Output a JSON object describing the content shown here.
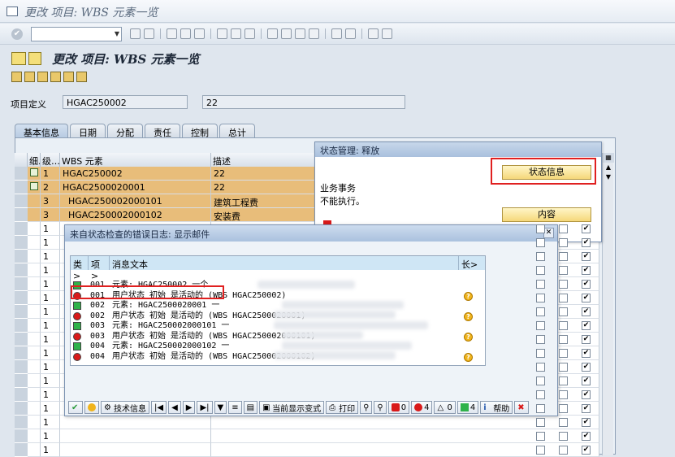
{
  "window": {
    "title": "更改 项目: WBS 元素一览"
  },
  "screen": {
    "title": "更改 项目: WBS 元素一览"
  },
  "project": {
    "label": "项目定义",
    "id": "HGAC250002",
    "desc": "22"
  },
  "tabs": [
    "基本信息",
    "日期",
    "分配",
    "责任",
    "控制",
    "总计"
  ],
  "grid": {
    "headers": {
      "a": "细.",
      "b": "级…",
      "c": "WBS 元素",
      "d": "描述"
    },
    "rows": [
      {
        "lvl": "1",
        "wbs": "HGAC250002",
        "desc": "22"
      },
      {
        "lvl": "2",
        "wbs": "HGAC2500020001",
        "desc": "22"
      },
      {
        "lvl": "3",
        "wbs": "HGAC250002000101",
        "desc": "建筑工程费"
      },
      {
        "lvl": "3",
        "wbs": "HGAC250002000102",
        "desc": "安装费"
      },
      {
        "lvl": "1"
      },
      {
        "lvl": "1"
      },
      {
        "lvl": "1"
      },
      {
        "lvl": "1"
      },
      {
        "lvl": "1"
      },
      {
        "lvl": "1"
      },
      {
        "lvl": "1"
      },
      {
        "lvl": "1"
      },
      {
        "lvl": "1"
      },
      {
        "lvl": "1"
      },
      {
        "lvl": "1"
      },
      {
        "lvl": "1"
      },
      {
        "lvl": "1"
      },
      {
        "lvl": "1"
      },
      {
        "lvl": "1"
      },
      {
        "lvl": "1"
      },
      {
        "lvl": "1"
      }
    ]
  },
  "status_dialog": {
    "title": "状态管理: 释放",
    "status_btn": "状态信息",
    "line1": "业务事务",
    "line2": "不能执行。",
    "content_btn": "内容"
  },
  "error_dialog": {
    "title": "来自状态检查的错误日志: 显示邮件",
    "col_type": "类>",
    "col_item": "项>",
    "col_text": "消息文本",
    "col_len": "长>",
    "messages": [
      {
        "type": "green",
        "num": "001",
        "text": "元素:  HGAC250002  一个"
      },
      {
        "type": "red",
        "num": "001",
        "text": "用户状态 初始 是活动的 (WBS HGAC250002)"
      },
      {
        "type": "green",
        "num": "002",
        "text": "元素:  HGAC2500020001  一"
      },
      {
        "type": "red",
        "num": "002",
        "text": "用户状态 初始 是活动的 (WBS HGAC2500020001)"
      },
      {
        "type": "green",
        "num": "003",
        "text": "元素:  HGAC250002000101  一"
      },
      {
        "type": "red",
        "num": "003",
        "text": "用户状态 初始 是活动的 (WBS HGAC250002000101)"
      },
      {
        "type": "green",
        "num": "004",
        "text": "元素:  HGAC250002000102  一"
      },
      {
        "type": "red",
        "num": "004",
        "text": "用户状态 初始 是活动的 (WBS HGAC250002000102)"
      }
    ],
    "footer": {
      "tech": "技术信息",
      "current": "当前显示变式",
      "print": "打印",
      "stop_count": "0",
      "err_count": "4",
      "warn_count": "0",
      "ok_count": "4",
      "help": "帮助"
    }
  },
  "colors": {
    "orange_row": "#e8bd7a",
    "dialog_title": "#a9c0dd",
    "highlight": "#e02020"
  }
}
